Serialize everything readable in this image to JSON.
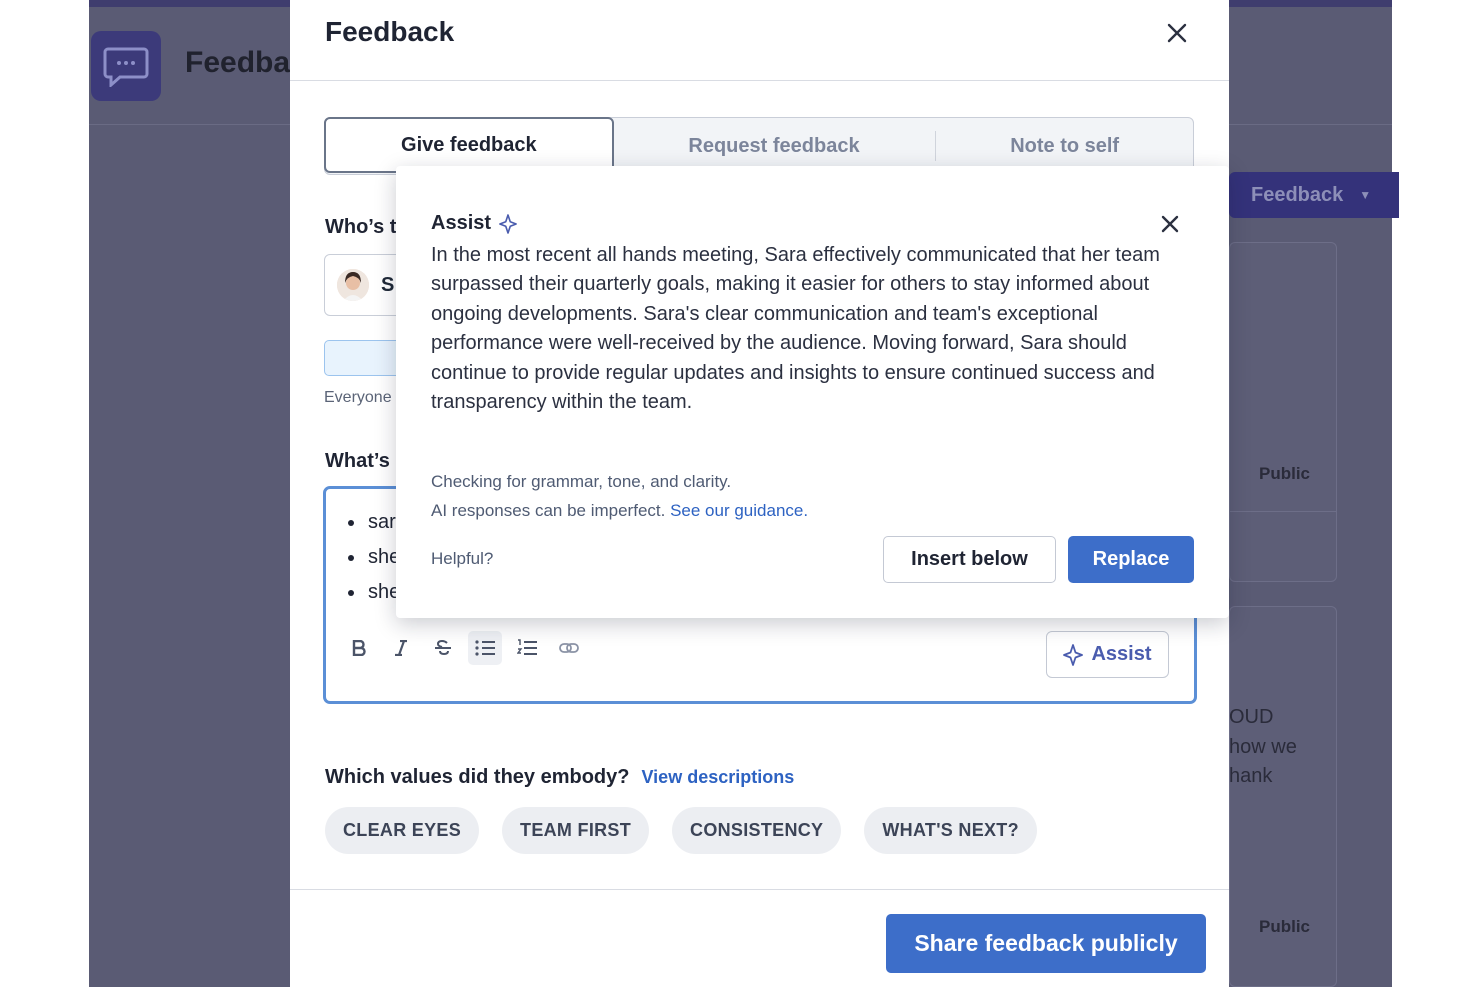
{
  "background": {
    "app_title": "Feedba",
    "feedback_button": "Feedback",
    "public_label_1": "Public",
    "public_label_2": "Public",
    "snippet_lines": [
      "OUD",
      "how we",
      "hank"
    ]
  },
  "modal": {
    "title": "Feedback",
    "tabs": [
      {
        "label": "Give feedback",
        "active": true
      },
      {
        "label": "Request feedback",
        "active": false
      },
      {
        "label": "Note to self",
        "active": false
      }
    ],
    "who_label": "Who’s t",
    "recipient_initial": "S",
    "visibility_helper": "Everyone",
    "whats_label": "What’s",
    "editor_bullets": [
      "sar",
      "she",
      "she"
    ],
    "assist_button": "Assist",
    "values_label": "Which values did they embody?",
    "values_link": "View descriptions",
    "values": [
      "CLEAR EYES",
      "TEAM FIRST",
      "CONSISTENCY",
      "WHAT'S NEXT?"
    ],
    "share_button": "Share feedback publicly"
  },
  "assist_popover": {
    "title": "Assist",
    "body": "In the most recent all hands meeting, Sara effectively communicated that her team surpassed their quarterly goals, making it easier for others to stay informed about ongoing developments. Sara's clear communication and team's exceptional performance were well-received by the audience. Moving forward, Sara should continue to provide regular updates and insights to ensure continued success and transparency within the team.",
    "checking_note": "Checking for grammar, tone, and clarity.",
    "disclaimer": "AI responses can be imperfect.",
    "guidance_link": "See our guidance.",
    "helpful_label": "Helpful?",
    "insert_button": "Insert below",
    "replace_button": "Replace"
  },
  "colors": {
    "accent": "#3d6ec9",
    "backdrop": "#5a5b74",
    "link": "#2d62c2",
    "assist_purple": "#4a5cae"
  }
}
